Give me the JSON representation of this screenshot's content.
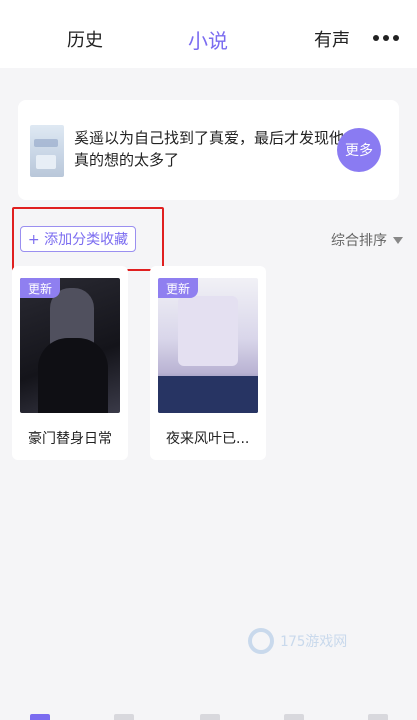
{
  "top_tabs": [
    {
      "label": "历史",
      "active": false
    },
    {
      "label": "小说",
      "active": true
    },
    {
      "label": "有声",
      "active": false
    }
  ],
  "header": {
    "more_icon": "more-dots-icon"
  },
  "banner": {
    "text": "奚遥以为自己找到了真爱，最后才发现他真的想的太多了",
    "more_label": "更多"
  },
  "shelf": {
    "add_category_label": "+ 添加分类收藏",
    "sort_label": "综合排序"
  },
  "books": [
    {
      "title": "豪门替身日常",
      "badge": "更新"
    },
    {
      "title": "夜来风叶已...",
      "badge": "更新"
    }
  ],
  "watermark": {
    "text": "175游戏网"
  },
  "colors": {
    "accent": "#7b6cf0",
    "highlight_box": "#e02020"
  }
}
